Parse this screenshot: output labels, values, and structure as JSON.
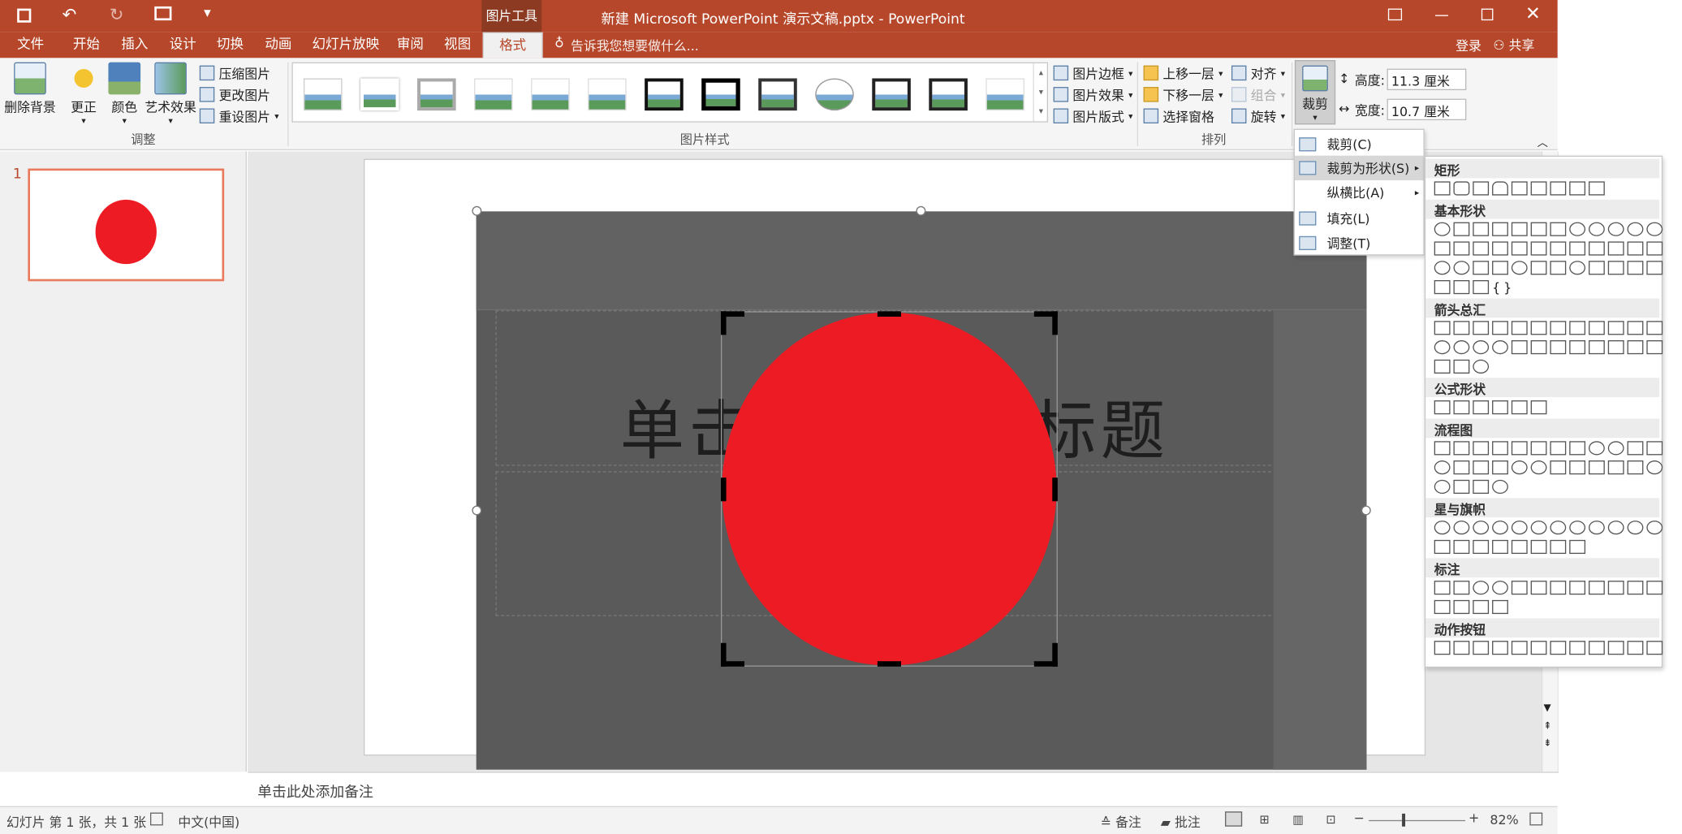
{
  "title": {
    "tool_context": "图片工具",
    "document": "新建 Microsoft PowerPoint 演示文稿.pptx - PowerPoint"
  },
  "quick_access": [
    "save-icon",
    "undo-icon",
    "redo-icon",
    "present-icon",
    "customize-icon"
  ],
  "tabs": [
    "文件",
    "开始",
    "插入",
    "设计",
    "切换",
    "动画",
    "幻灯片放映",
    "审阅",
    "视图",
    "格式"
  ],
  "tell_me": "告诉我您想要做什么...",
  "login": "登录",
  "share": "共享",
  "ribbon": {
    "adjust": {
      "remove_bg": "删除背景",
      "correct": "更正",
      "color": "颜色",
      "artistic": "艺术效果",
      "compress": "压缩图片",
      "change": "更改图片",
      "reset": "重设图片",
      "label": "调整"
    },
    "styles": {
      "label": "图片样式",
      "border": "图片边框",
      "effects": "图片效果",
      "layout": "图片版式"
    },
    "arrange": {
      "forward": "上移一层",
      "backward": "下移一层",
      "pane": "选择窗格",
      "align": "对齐",
      "group": "组合",
      "rotate": "旋转",
      "label": "排列"
    },
    "size": {
      "crop": "裁剪",
      "height_label": "高度:",
      "height": "11.3 厘米",
      "width_label": "宽度:",
      "width": "10.7 厘米"
    }
  },
  "crop_menu": [
    "裁剪(C)",
    "裁剪为形状(S)",
    "纵横比(A)",
    "填充(L)",
    "调整(T)"
  ],
  "shape_panel": {
    "sections": [
      "矩形",
      "基本形状",
      "箭头总汇",
      "公式形状",
      "流程图",
      "星与旗帜",
      "标注",
      "动作按钮"
    ]
  },
  "slide": {
    "number": "1",
    "title_placeholder": "单击此处添加标题",
    "brace_left": "{",
    "brace_right": "}"
  },
  "notes": "单击此处添加备注",
  "status": {
    "slide": "幻灯片 第 1 张，共 1 张",
    "lang": "中文(中国)",
    "notes": "备注",
    "comments": "批注",
    "zoom": "82%"
  },
  "colors": {
    "accent": "#b7472a",
    "circle": "#ed1c24"
  }
}
